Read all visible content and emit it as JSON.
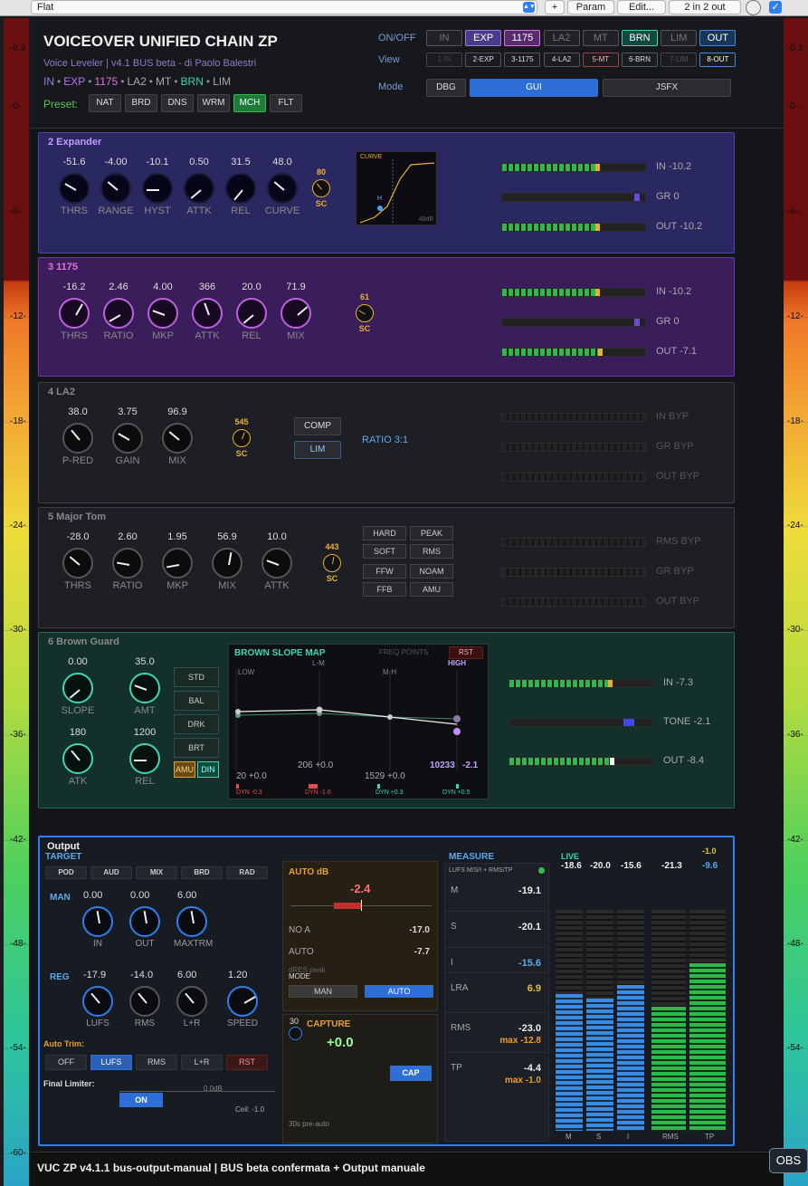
{
  "topbar": {
    "preset": "Flat",
    "plus": "+",
    "param": "Param",
    "edit": "Edit...",
    "routing": "2 in 2 out"
  },
  "meter": {
    "left_ticks": [
      "-6.9",
      "-0-",
      "-6-",
      "-12-",
      "-18-",
      "-24-",
      "-30-",
      "-36-",
      "-42-",
      "-48-",
      "-54-",
      "-60-"
    ],
    "right_ticks": [
      "-0.3",
      "-0-",
      "-6-",
      "-12-",
      "-18-",
      "-24-",
      "-30-",
      "-36-",
      "-42-",
      "-48-",
      "-54-",
      "-60-"
    ]
  },
  "header": {
    "title": "VOICEOVER UNIFIED CHAIN ZP",
    "subtitle": "Voice Leveler | v4.1 BUS beta - di Paolo Balestri",
    "chain": [
      {
        "t": "IN",
        "c": "#9a7be0"
      },
      {
        "t": "•",
        "c": "#888"
      },
      {
        "t": "EXP",
        "c": "#c070ff"
      },
      {
        "t": "•",
        "c": "#888"
      },
      {
        "t": "1175",
        "c": "#e070e0"
      },
      {
        "t": "•",
        "c": "#888"
      },
      {
        "t": "LA2",
        "c": "#aaa"
      },
      {
        "t": "•",
        "c": "#888"
      },
      {
        "t": "MT",
        "c": "#aaa"
      },
      {
        "t": "•",
        "c": "#888"
      },
      {
        "t": "BRN",
        "c": "#3ed6b4"
      },
      {
        "t": "•",
        "c": "#888"
      },
      {
        "t": "LIM",
        "c": "#aaa"
      }
    ],
    "preset_label": "Preset:",
    "presets": [
      "NAT",
      "BRD",
      "DNS",
      "WRM",
      "MCH",
      "FLT"
    ],
    "active_preset": "MCH",
    "onoff_label": "ON/OFF",
    "view_label": "View",
    "mode_label": "Mode",
    "onoff": [
      "IN",
      "EXP",
      "1175",
      "LA2",
      "MT",
      "BRN",
      "LIM",
      "OUT"
    ],
    "view": [
      "1-IN",
      "2-EXP",
      "3-1175",
      "4-LA2",
      "5-MT",
      "6-BRN",
      "7-LIM",
      "8-OUT"
    ],
    "modes": [
      "DBG",
      "GUI",
      "JSFX"
    ]
  },
  "expander": {
    "title": "2  Expander",
    "knobs": [
      {
        "v": "-51.6",
        "l": "THRS",
        "a": -60
      },
      {
        "v": "-4.00",
        "l": "RANGE",
        "a": -50
      },
      {
        "v": "-10.1",
        "l": "HYST",
        "a": -90
      },
      {
        "v": "0.50",
        "l": "ATTK",
        "a": -130
      },
      {
        "v": "31.5",
        "l": "REL",
        "a": -140
      },
      {
        "v": "48.0",
        "l": "CURVE",
        "a": -50
      }
    ],
    "sc": {
      "v": "80",
      "l": "SC"
    },
    "curve_label": "CURVE",
    "curve_h": "H",
    "curve_db": "48dB",
    "meters": [
      {
        "l": "IN -10.2",
        "f": 0.68
      },
      {
        "l": "GR 0",
        "f": 0
      },
      {
        "l": "OUT -10.2",
        "f": 0.68
      }
    ]
  },
  "c1175": {
    "title": "3  1175",
    "knobs": [
      {
        "v": "-16.2",
        "l": "THRS",
        "a": 30
      },
      {
        "v": "2.46",
        "l": "RATIO",
        "a": -120
      },
      {
        "v": "4.00",
        "l": "MKP",
        "a": -70
      },
      {
        "v": "366",
        "l": "ATTK",
        "a": -20
      },
      {
        "v": "20.0",
        "l": "REL",
        "a": -130
      },
      {
        "v": "71.9",
        "l": "MIX",
        "a": 50
      }
    ],
    "sc": {
      "v": "61",
      "l": "SC"
    },
    "meters": [
      {
        "l": "IN -10.2",
        "f": 0.68
      },
      {
        "l": "GR 0",
        "f": 0
      },
      {
        "l": "OUT -7.1",
        "f": 0.7
      }
    ]
  },
  "la2": {
    "title": "4  LA2",
    "knobs": [
      {
        "v": "38.0",
        "l": "P-RED",
        "a": -40
      },
      {
        "v": "3.75",
        "l": "GAIN",
        "a": -60
      },
      {
        "v": "96.9",
        "l": "MIX",
        "a": -50
      }
    ],
    "sc": {
      "v": "545",
      "l": "SC"
    },
    "buttons": [
      "COMP",
      "LIM"
    ],
    "ratio": "RATIO 3:1",
    "meters": [
      {
        "l": "IN BYP"
      },
      {
        "l": "GR BYP"
      },
      {
        "l": "OUT BYP"
      }
    ]
  },
  "majortom": {
    "title": "5  Major Tom",
    "knobs": [
      {
        "v": "-28.0",
        "l": "THRS",
        "a": -50
      },
      {
        "v": "2.60",
        "l": "RATIO",
        "a": -80
      },
      {
        "v": "1.95",
        "l": "MKP",
        "a": -100
      },
      {
        "v": "56.9",
        "l": "MIX",
        "a": 10
      },
      {
        "v": "10.0",
        "l": "ATTK",
        "a": -70
      }
    ],
    "sc": {
      "v": "443",
      "l": "SC"
    },
    "buttons": [
      "HARD",
      "PEAK",
      "SOFT",
      "RMS",
      "FFW",
      "NOAM",
      "FFB",
      "AMU"
    ],
    "meters": [
      {
        "l": "RMS BYP"
      },
      {
        "l": "GR BYP"
      },
      {
        "l": "OUT BYP"
      }
    ]
  },
  "brown": {
    "title": "6  Brown Guard",
    "knobs": [
      {
        "v": "0.00",
        "l": "SLOPE",
        "a": -130
      },
      {
        "v": "35.0",
        "l": "AMT",
        "a": -70
      },
      {
        "v": "180",
        "l": "ATK",
        "a": -40
      },
      {
        "v": "1200",
        "l": "REL",
        "a": -90
      }
    ],
    "modes": [
      "STD",
      "BAL",
      "DRK",
      "BRT"
    ],
    "amu": "AMU",
    "din": "DIN",
    "map": {
      "title": "BROWN SLOPE MAP",
      "freq": "FREQ POINTS",
      "rst": "RST",
      "low": "LOW",
      "lm": "L-M",
      "mh": "M-H",
      "high": "HIGH",
      "p1": "20  +0.0",
      "p2": "206  +0.0",
      "p3": "1529  +0.0",
      "p4f": "10233",
      "p4v": "-2.1",
      "dyn": [
        "DYN -0.3",
        "DYN -1.6",
        "DYN +0.3",
        "DYN +0.5"
      ]
    },
    "meters": [
      {
        "l": "IN -7.3",
        "f": 0.72
      },
      {
        "l": "TONE -2.1",
        "f": 0.82
      },
      {
        "l": "OUT -8.4",
        "f": 0.73
      }
    ]
  },
  "output": {
    "title": "Output",
    "target_label": "TARGET",
    "targets": [
      "POD",
      "AUD",
      "MIX",
      "BRD",
      "RAD"
    ],
    "man_label": "MAN",
    "man_knobs": [
      {
        "v": "0.00",
        "l": "IN",
        "a": -10
      },
      {
        "v": "0.00",
        "l": "OUT",
        "a": -10
      },
      {
        "v": "6.00",
        "l": "MAXTRM",
        "a": -10
      }
    ],
    "reg_label": "REG",
    "reg_knobs": [
      {
        "v": "-17.9",
        "l": "LUFS",
        "a": -40
      },
      {
        "v": "-14.0",
        "l": "RMS",
        "a": -40
      },
      {
        "v": "6.00",
        "l": "L+R",
        "a": -40
      },
      {
        "v": "1.20",
        "l": "SPEED",
        "a": 60
      }
    ],
    "autotrim_label": "Auto Trim:",
    "autotrim": [
      "OFF",
      "LUFS",
      "RMS",
      "L+R",
      "RST"
    ],
    "final_label": "Final Limiter:",
    "final_db": "0.0dB",
    "final_on": "ON",
    "ceil": "Ceil: -1.0",
    "auto_db_label": "AUTO dB",
    "auto_db": "-2.4",
    "noa_label": "NO A",
    "noa": "-17.0",
    "auto_label": "AUTO",
    "auto": "-7.7",
    "mode_label": "MODE",
    "dres": "dRES peak",
    "mode_man": "MAN",
    "mode_auto": "AUTO",
    "capture_num": "30",
    "capture_label": "CAPTURE",
    "capture_val": "+0.0",
    "cap_btn": "CAP",
    "pre_auto": "30s pre-auto",
    "measure_label": "MEASURE",
    "measure_sub": "LUFS M/S/I + RMS/TP",
    "m_label": "M",
    "m": "-19.1",
    "s_label": "S",
    "s": "-20.1",
    "i_label": "I",
    "i": "-15.6",
    "lra_label": "LRA",
    "lra": "6.9",
    "rms_label": "RMS",
    "rms": "-23.0",
    "rms_max": "max -12.8",
    "tp_label": "TP",
    "tp": "-4.4",
    "tp_max": "max -1.0",
    "live_label": "LIVE",
    "live": [
      "-18.6",
      "-20.0",
      "-15.6",
      "-21.3",
      "-9.6"
    ],
    "live_tp_peak": "-1.0",
    "bars": [
      {
        "l": "M",
        "f": 0.62,
        "c": "b"
      },
      {
        "l": "S",
        "f": 0.6,
        "c": "b"
      },
      {
        "l": "I",
        "f": 0.66,
        "c": "b"
      },
      {
        "l": "RMS",
        "f": 0.56,
        "c": "g"
      },
      {
        "l": "TP",
        "f": 0.76,
        "c": "g"
      }
    ]
  },
  "status": {
    "text": "VUC ZP v4.1.1 bus-output-manual | BUS beta confermata + Output manuale",
    "obs": "OBS"
  }
}
